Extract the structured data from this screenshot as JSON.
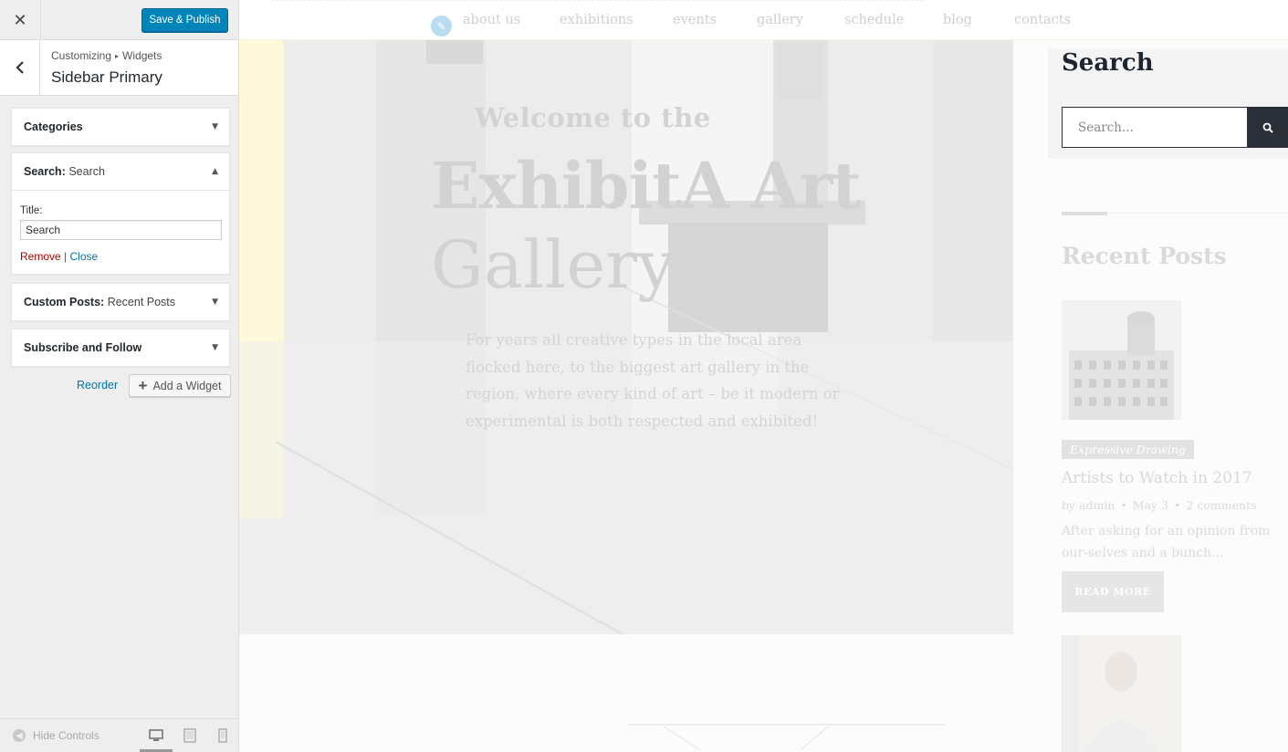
{
  "customizer": {
    "close_icon": "close-icon",
    "publish_label": "Save & Publish",
    "back_icon": "chevron-left-icon",
    "breadcrumb": {
      "root": "Customizing",
      "current": "Widgets"
    },
    "section_title": "Sidebar Primary",
    "widgets": [
      {
        "title": "Categories",
        "subtitle": ""
      },
      {
        "title": "Search:",
        "subtitle": "Search"
      },
      {
        "title": "Custom Posts:",
        "subtitle": "Recent Posts"
      },
      {
        "title": "Subscribe and Follow",
        "subtitle": ""
      }
    ],
    "search_widget": {
      "title_label": "Title:",
      "title_value": "Search",
      "remove_label": "Remove",
      "separator": "|",
      "close_label": "Close"
    },
    "reorder_label": "Reorder",
    "add_widget_label": "Add a Widget",
    "hide_controls_label": "Hide Controls"
  },
  "preview": {
    "nav": [
      "about us",
      "exhibitions",
      "events",
      "gallery",
      "schedule",
      "blog",
      "contacts"
    ],
    "hero": {
      "welcome": "Welcome to the",
      "title_line1": "ExhibitA Art",
      "title_line2": "Gallery",
      "description": "For years all creative types in the local area flocked here, to the biggest art gallery in the region, where every kind of art – be it modern or experimental is both respected and exhibited!"
    },
    "sidebar": {
      "search_title": "Search",
      "search_placeholder": "Search...",
      "recent_title": "Recent Posts",
      "post": {
        "category": "Expressive Drawing",
        "title": "Artists to Watch in 2017",
        "author": "by admin",
        "date": "May 3",
        "comments": "2 comments",
        "excerpt": "After asking for an opinion from our-selves and a bunch...",
        "read_more": "READ MORE"
      }
    }
  },
  "colors": {
    "primary_button": "#0085ba",
    "remove_link": "#aa0000",
    "link": "#0073aa",
    "sidebar_dark": "#2a2f38"
  }
}
